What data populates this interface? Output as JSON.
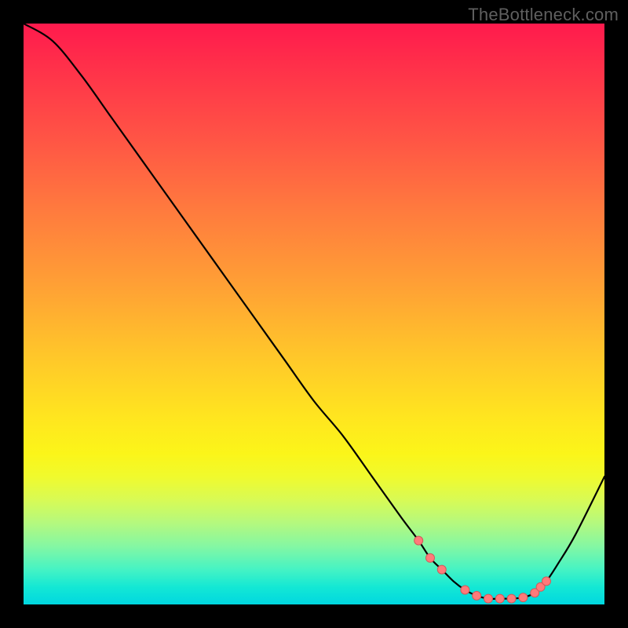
{
  "attribution": "TheBottleneck.com",
  "colors": {
    "curve": "#000000",
    "marker_fill": "#ff7a7a",
    "marker_stroke": "#d15a5a"
  },
  "chart_data": {
    "type": "line",
    "title": "",
    "xlabel": "",
    "ylabel": "",
    "xlim": [
      0,
      100
    ],
    "ylim": [
      0,
      100
    ],
    "x": [
      0,
      5,
      10,
      15,
      20,
      25,
      30,
      35,
      40,
      45,
      50,
      55,
      60,
      65,
      68,
      70,
      72,
      74,
      76,
      78,
      80,
      82,
      84,
      86,
      88,
      90,
      92,
      95,
      100
    ],
    "values": [
      100,
      97,
      91,
      84,
      77,
      70,
      63,
      56,
      49,
      42,
      35,
      29,
      22,
      15,
      11,
      8,
      6,
      4,
      2.5,
      1.5,
      1,
      1,
      1,
      1.2,
      2,
      4,
      7,
      12,
      22
    ],
    "markers_x": [
      68,
      70,
      72,
      76,
      78,
      80,
      82,
      84,
      86,
      88,
      89,
      90
    ],
    "markers_y": [
      11,
      8,
      6,
      2.5,
      1.5,
      1,
      1,
      1,
      1.2,
      2,
      3,
      4
    ]
  }
}
